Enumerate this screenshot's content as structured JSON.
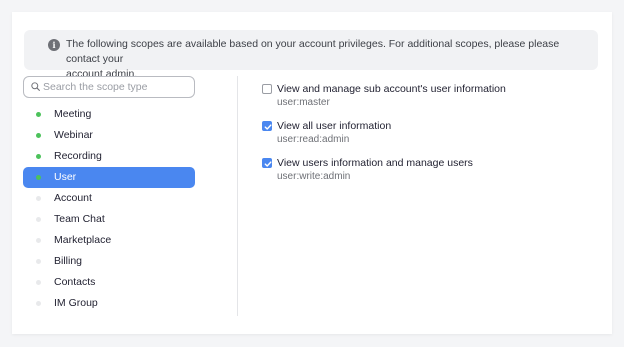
{
  "banner": {
    "icon": "info-icon",
    "line1": "The following scopes are available based on your account privileges. For additional scopes, please please contact your",
    "line2": "account admin."
  },
  "search": {
    "placeholder": "Search the scope type",
    "value": "",
    "icon": "search-icon"
  },
  "colors": {
    "accent": "#4a87f0",
    "dot_active": "#4cc25b",
    "dot_inactive": "#e8e9eb"
  },
  "scopes": [
    {
      "label": "Meeting",
      "active": true,
      "selected": false
    },
    {
      "label": "Webinar",
      "active": true,
      "selected": false
    },
    {
      "label": "Recording",
      "active": true,
      "selected": false
    },
    {
      "label": "User",
      "active": true,
      "selected": true
    },
    {
      "label": "Account",
      "active": false,
      "selected": false
    },
    {
      "label": "Team Chat",
      "active": false,
      "selected": false
    },
    {
      "label": "Marketplace",
      "active": false,
      "selected": false
    },
    {
      "label": "Billing",
      "active": false,
      "selected": false
    },
    {
      "label": "Contacts",
      "active": false,
      "selected": false
    },
    {
      "label": "IM Group",
      "active": false,
      "selected": false
    }
  ],
  "permissions": [
    {
      "title": "View and manage sub account's user information",
      "scope": "user:master",
      "checked": false
    },
    {
      "title": "View all user information",
      "scope": "user:read:admin",
      "checked": true
    },
    {
      "title": "View users information and manage users",
      "scope": "user:write:admin",
      "checked": true
    }
  ]
}
